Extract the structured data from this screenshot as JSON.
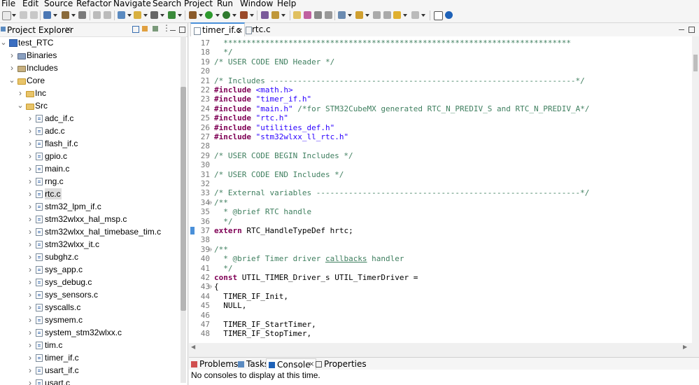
{
  "menu": [
    "File",
    "Edit",
    "Source",
    "Refactor",
    "Navigate",
    "Search",
    "Project",
    "Run",
    "Window",
    "Help"
  ],
  "explorer": {
    "title": "Project Explorer",
    "close": "×",
    "tree": [
      {
        "label": "test_RTC",
        "icon": "project-icon",
        "twisty": "v"
      },
      {
        "label": "Binaries",
        "icon": "binaries-icon",
        "twisty": ">"
      },
      {
        "label": "Includes",
        "icon": "includes-icon",
        "twisty": ">"
      },
      {
        "label": "Core",
        "icon": "folder-icon",
        "twisty": "v"
      },
      {
        "label": "Inc",
        "icon": "folder-icon",
        "twisty": ">"
      },
      {
        "label": "Src",
        "icon": "folder-icon",
        "twisty": "v"
      },
      {
        "label": "adc_if.c",
        "icon": "c-file-icon",
        "twisty": ">"
      },
      {
        "label": "adc.c",
        "icon": "c-file-icon",
        "twisty": ">"
      },
      {
        "label": "flash_if.c",
        "icon": "c-file-icon",
        "twisty": ">"
      },
      {
        "label": "gpio.c",
        "icon": "c-file-icon",
        "twisty": ">"
      },
      {
        "label": "main.c",
        "icon": "c-file-icon",
        "twisty": ">"
      },
      {
        "label": "rng.c",
        "icon": "c-file-icon",
        "twisty": ">"
      },
      {
        "label": "rtc.c",
        "icon": "c-file-icon",
        "twisty": ">",
        "selected": true
      },
      {
        "label": "stm32_lpm_if.c",
        "icon": "c-file-icon",
        "twisty": ">"
      },
      {
        "label": "stm32wlxx_hal_msp.c",
        "icon": "c-file-icon",
        "twisty": ">"
      },
      {
        "label": "stm32wlxx_hal_timebase_tim.c",
        "icon": "c-file-icon",
        "twisty": ">"
      },
      {
        "label": "stm32wlxx_it.c",
        "icon": "c-file-icon",
        "twisty": ">"
      },
      {
        "label": "subghz.c",
        "icon": "c-file-icon",
        "twisty": ">"
      },
      {
        "label": "sys_app.c",
        "icon": "c-file-icon",
        "twisty": ">"
      },
      {
        "label": "sys_debug.c",
        "icon": "c-file-icon",
        "twisty": ">"
      },
      {
        "label": "sys_sensors.c",
        "icon": "c-file-icon",
        "twisty": ">"
      },
      {
        "label": "syscalls.c",
        "icon": "c-file-icon",
        "twisty": ">"
      },
      {
        "label": "sysmem.c",
        "icon": "c-file-icon",
        "twisty": ">"
      },
      {
        "label": "system_stm32wlxx.c",
        "icon": "c-file-icon",
        "twisty": ">"
      },
      {
        "label": "tim.c",
        "icon": "c-file-icon",
        "twisty": ">"
      },
      {
        "label": "timer_if.c",
        "icon": "c-file-icon",
        "twisty": ">"
      },
      {
        "label": "usart_if.c",
        "icon": "c-file-icon",
        "twisty": ">"
      },
      {
        "label": "usart.c",
        "icon": "c-file-icon",
        "twisty": ">"
      }
    ]
  },
  "editor": {
    "tabs": [
      {
        "label": "timer_if.c",
        "close": "×",
        "active": true
      },
      {
        "label": "rtc.c",
        "active": false
      }
    ],
    "lines": [
      {
        "n": "17",
        "fold": "",
        "segs": [
          [
            "c",
            "  ***************************************************************************"
          ]
        ]
      },
      {
        "n": "18",
        "fold": "",
        "segs": [
          [
            "c",
            "  */"
          ]
        ]
      },
      {
        "n": "19",
        "fold": "",
        "segs": [
          [
            "c",
            "/* USER CODE END Header */"
          ]
        ]
      },
      {
        "n": "20",
        "fold": "",
        "segs": []
      },
      {
        "n": "21",
        "fold": "",
        "segs": [
          [
            "c",
            "/* Includes ------------------------------------------------------------------*/"
          ]
        ]
      },
      {
        "n": "22",
        "fold": "",
        "segs": [
          [
            "k",
            "#include"
          ],
          [
            "p",
            " "
          ],
          [
            "s",
            "<math.h>"
          ]
        ]
      },
      {
        "n": "23",
        "fold": "",
        "segs": [
          [
            "k",
            "#include"
          ],
          [
            "p",
            " "
          ],
          [
            "s",
            "\"timer_if.h\""
          ]
        ]
      },
      {
        "n": "24",
        "fold": "",
        "segs": [
          [
            "k",
            "#include"
          ],
          [
            "p",
            " "
          ],
          [
            "s",
            "\"main.h\""
          ],
          [
            "p",
            " "
          ],
          [
            "c",
            "/*for STM32CubeMX generated RTC_N_PREDIV_S and RTC_N_PREDIV_A*/"
          ]
        ]
      },
      {
        "n": "25",
        "fold": "",
        "segs": [
          [
            "k",
            "#include"
          ],
          [
            "p",
            " "
          ],
          [
            "s",
            "\"rtc.h\""
          ]
        ]
      },
      {
        "n": "26",
        "fold": "",
        "segs": [
          [
            "k",
            "#include"
          ],
          [
            "p",
            " "
          ],
          [
            "s",
            "\"utilities_def.h\""
          ]
        ]
      },
      {
        "n": "27",
        "fold": "",
        "segs": [
          [
            "k",
            "#include"
          ],
          [
            "p",
            " "
          ],
          [
            "s",
            "\"stm32wlxx_ll_rtc.h\""
          ]
        ]
      },
      {
        "n": "28",
        "fold": "",
        "segs": []
      },
      {
        "n": "29",
        "fold": "",
        "segs": [
          [
            "c",
            "/* USER CODE BEGIN Includes */"
          ]
        ]
      },
      {
        "n": "30",
        "fold": "",
        "segs": []
      },
      {
        "n": "31",
        "fold": "",
        "segs": [
          [
            "c",
            "/* USER CODE END Includes */"
          ]
        ]
      },
      {
        "n": "32",
        "fold": "",
        "segs": []
      },
      {
        "n": "33",
        "fold": "",
        "segs": [
          [
            "c",
            "/* External variables ---------------------------------------------------------*/"
          ]
        ]
      },
      {
        "n": "34",
        "fold": "⊖",
        "segs": [
          [
            "c",
            "/**"
          ]
        ]
      },
      {
        "n": "35",
        "fold": "",
        "segs": [
          [
            "c",
            "  * @brief RTC handle"
          ]
        ]
      },
      {
        "n": "36",
        "fold": "",
        "segs": [
          [
            "c",
            "  */"
          ]
        ]
      },
      {
        "n": "37",
        "fold": "",
        "segs": [
          [
            "k",
            "extern"
          ],
          [
            "p",
            " RTC_HandleTypeDef hrtc;"
          ]
        ]
      },
      {
        "n": "38",
        "fold": "",
        "segs": []
      },
      {
        "n": "39",
        "fold": "⊖",
        "segs": [
          [
            "c",
            "/**"
          ]
        ]
      },
      {
        "n": "40",
        "fold": "",
        "segs": [
          [
            "c",
            "  * @brief Timer driver "
          ],
          [
            "u",
            "callbacks"
          ],
          [
            "c",
            " handler"
          ]
        ]
      },
      {
        "n": "41",
        "fold": "",
        "segs": [
          [
            "c",
            "  */"
          ]
        ]
      },
      {
        "n": "42",
        "fold": "",
        "segs": [
          [
            "k",
            "const"
          ],
          [
            "p",
            " UTIL_TIMER_Driver_s UTIL_TimerDriver ="
          ]
        ]
      },
      {
        "n": "43",
        "fold": "⊖",
        "segs": [
          [
            "p",
            "{"
          ]
        ]
      },
      {
        "n": "44",
        "fold": "",
        "segs": [
          [
            "p",
            "  TIMER_IF_Init,"
          ]
        ]
      },
      {
        "n": "45",
        "fold": "",
        "segs": [
          [
            "p",
            "  NULL,"
          ]
        ]
      },
      {
        "n": "46",
        "fold": "",
        "segs": []
      },
      {
        "n": "47",
        "fold": "",
        "segs": [
          [
            "p",
            "  TIMER_IF_StartTimer,"
          ]
        ]
      },
      {
        "n": "48",
        "fold": "",
        "segs": [
          [
            "p",
            "  TIMER_IF_StopTimer,"
          ]
        ]
      }
    ]
  },
  "bottom": {
    "tabs": [
      {
        "label": "Problems",
        "icon": "problems-icon",
        "active": false
      },
      {
        "label": "Tasks",
        "icon": "tasks-icon",
        "active": false
      },
      {
        "label": "Console",
        "icon": "console-icon",
        "active": true
      },
      {
        "label": "Properties",
        "icon": "properties-icon",
        "active": false
      }
    ],
    "console_text": "No consoles to display at this time."
  },
  "colors": {
    "accent": "#4a90d9",
    "comment": "#3f7f5f",
    "keyword": "#7f0055",
    "string": "#2a00ff",
    "selection": "#dddddd"
  }
}
